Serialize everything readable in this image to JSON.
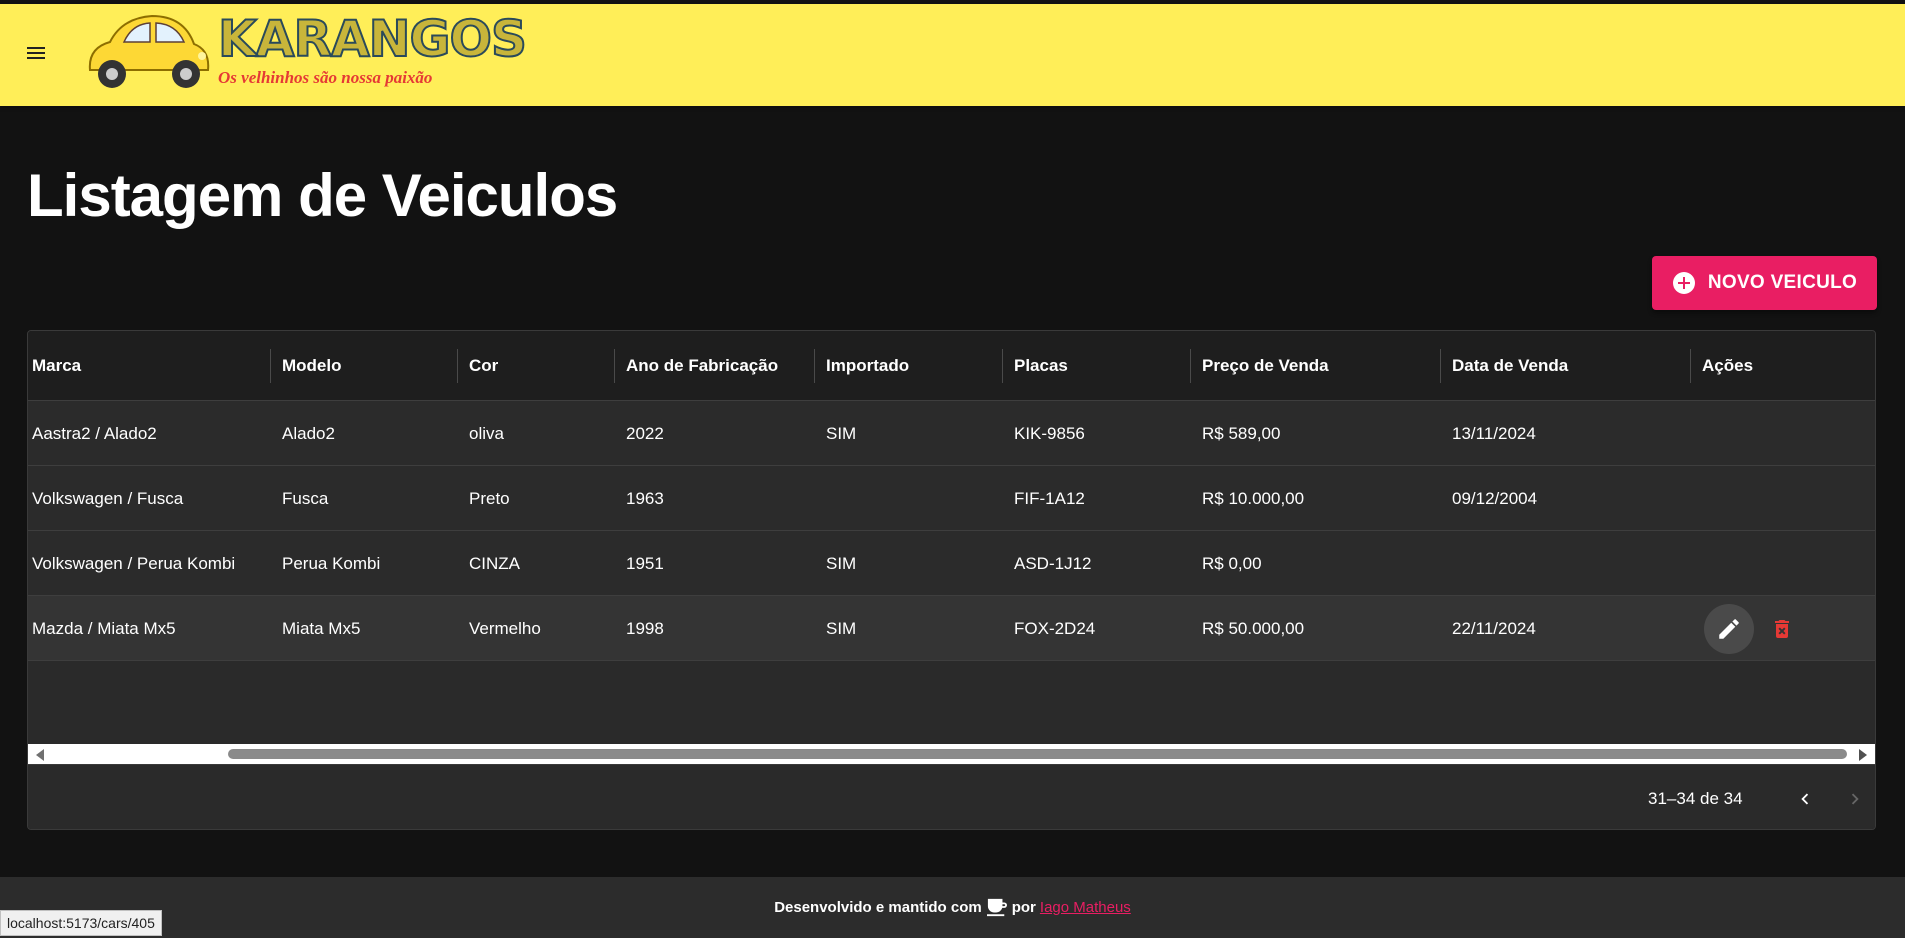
{
  "header": {
    "logo_text": "KARANGOS",
    "slogan": "Os velhinhos são nossa paixão"
  },
  "page": {
    "title": "Listagem de Veiculos",
    "new_button_label": "NOVO VEICULO"
  },
  "table": {
    "columns": [
      "Marca",
      "Modelo",
      "Cor",
      "Ano de Fabricação",
      "Importado",
      "Placas",
      "Preço de Venda",
      "Data de Venda",
      "Ações"
    ],
    "rows": [
      {
        "marca": "Aastra2 / Alado2",
        "modelo": "Alado2",
        "cor": "oliva",
        "ano": "2022",
        "importado": "SIM",
        "placas": "KIK-9856",
        "preco": "R$ 589,00",
        "data": "13/11/2024"
      },
      {
        "marca": "Volkswagen / Fusca",
        "modelo": "Fusca",
        "cor": "Preto",
        "ano": "1963",
        "importado": "",
        "placas": "FIF-1A12",
        "preco": "R$ 10.000,00",
        "data": "09/12/2004"
      },
      {
        "marca": "Volkswagen / Perua Kombi",
        "modelo": "Perua Kombi",
        "cor": "CINZA",
        "ano": "1951",
        "importado": "SIM",
        "placas": "ASD-1J12",
        "preco": "R$ 0,00",
        "data": ""
      },
      {
        "marca": "Mazda / Miata Mx5",
        "modelo": "Miata Mx5",
        "cor": "Vermelho",
        "ano": "1998",
        "importado": "SIM",
        "placas": "FOX-2D24",
        "preco": "R$ 50.000,00",
        "data": "22/11/2024"
      }
    ]
  },
  "pagination": {
    "range_text": "31–34 de 34"
  },
  "footer": {
    "text_before": "Desenvolvido e mantido com",
    "text_por": "por",
    "author": "Iago Matheus"
  },
  "status_bar": {
    "url": "localhost:5173/cars/405"
  },
  "colors": {
    "appbar": "#ffee58",
    "accent": "#e91e63",
    "background": "#121212",
    "delete": "#e53935"
  }
}
